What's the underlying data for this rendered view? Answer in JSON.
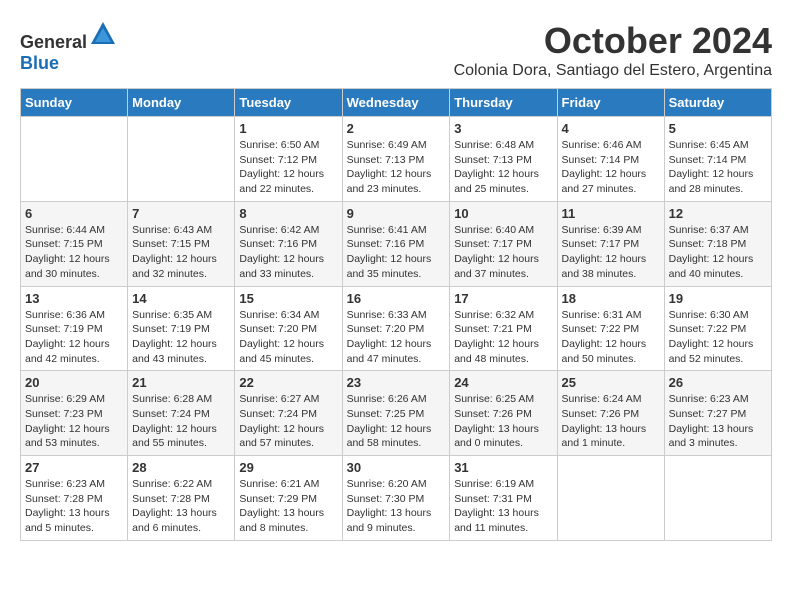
{
  "logo": {
    "general": "General",
    "blue": "Blue"
  },
  "title": {
    "month": "October 2024",
    "subtitle": "Colonia Dora, Santiago del Estero, Argentina"
  },
  "headers": [
    "Sunday",
    "Monday",
    "Tuesday",
    "Wednesday",
    "Thursday",
    "Friday",
    "Saturday"
  ],
  "weeks": [
    [
      {
        "day": "",
        "info": ""
      },
      {
        "day": "",
        "info": ""
      },
      {
        "day": "1",
        "info": "Sunrise: 6:50 AM\nSunset: 7:12 PM\nDaylight: 12 hours\nand 22 minutes."
      },
      {
        "day": "2",
        "info": "Sunrise: 6:49 AM\nSunset: 7:13 PM\nDaylight: 12 hours\nand 23 minutes."
      },
      {
        "day": "3",
        "info": "Sunrise: 6:48 AM\nSunset: 7:13 PM\nDaylight: 12 hours\nand 25 minutes."
      },
      {
        "day": "4",
        "info": "Sunrise: 6:46 AM\nSunset: 7:14 PM\nDaylight: 12 hours\nand 27 minutes."
      },
      {
        "day": "5",
        "info": "Sunrise: 6:45 AM\nSunset: 7:14 PM\nDaylight: 12 hours\nand 28 minutes."
      }
    ],
    [
      {
        "day": "6",
        "info": "Sunrise: 6:44 AM\nSunset: 7:15 PM\nDaylight: 12 hours\nand 30 minutes."
      },
      {
        "day": "7",
        "info": "Sunrise: 6:43 AM\nSunset: 7:15 PM\nDaylight: 12 hours\nand 32 minutes."
      },
      {
        "day": "8",
        "info": "Sunrise: 6:42 AM\nSunset: 7:16 PM\nDaylight: 12 hours\nand 33 minutes."
      },
      {
        "day": "9",
        "info": "Sunrise: 6:41 AM\nSunset: 7:16 PM\nDaylight: 12 hours\nand 35 minutes."
      },
      {
        "day": "10",
        "info": "Sunrise: 6:40 AM\nSunset: 7:17 PM\nDaylight: 12 hours\nand 37 minutes."
      },
      {
        "day": "11",
        "info": "Sunrise: 6:39 AM\nSunset: 7:17 PM\nDaylight: 12 hours\nand 38 minutes."
      },
      {
        "day": "12",
        "info": "Sunrise: 6:37 AM\nSunset: 7:18 PM\nDaylight: 12 hours\nand 40 minutes."
      }
    ],
    [
      {
        "day": "13",
        "info": "Sunrise: 6:36 AM\nSunset: 7:19 PM\nDaylight: 12 hours\nand 42 minutes."
      },
      {
        "day": "14",
        "info": "Sunrise: 6:35 AM\nSunset: 7:19 PM\nDaylight: 12 hours\nand 43 minutes."
      },
      {
        "day": "15",
        "info": "Sunrise: 6:34 AM\nSunset: 7:20 PM\nDaylight: 12 hours\nand 45 minutes."
      },
      {
        "day": "16",
        "info": "Sunrise: 6:33 AM\nSunset: 7:20 PM\nDaylight: 12 hours\nand 47 minutes."
      },
      {
        "day": "17",
        "info": "Sunrise: 6:32 AM\nSunset: 7:21 PM\nDaylight: 12 hours\nand 48 minutes."
      },
      {
        "day": "18",
        "info": "Sunrise: 6:31 AM\nSunset: 7:22 PM\nDaylight: 12 hours\nand 50 minutes."
      },
      {
        "day": "19",
        "info": "Sunrise: 6:30 AM\nSunset: 7:22 PM\nDaylight: 12 hours\nand 52 minutes."
      }
    ],
    [
      {
        "day": "20",
        "info": "Sunrise: 6:29 AM\nSunset: 7:23 PM\nDaylight: 12 hours\nand 53 minutes."
      },
      {
        "day": "21",
        "info": "Sunrise: 6:28 AM\nSunset: 7:24 PM\nDaylight: 12 hours\nand 55 minutes."
      },
      {
        "day": "22",
        "info": "Sunrise: 6:27 AM\nSunset: 7:24 PM\nDaylight: 12 hours\nand 57 minutes."
      },
      {
        "day": "23",
        "info": "Sunrise: 6:26 AM\nSunset: 7:25 PM\nDaylight: 12 hours\nand 58 minutes."
      },
      {
        "day": "24",
        "info": "Sunrise: 6:25 AM\nSunset: 7:26 PM\nDaylight: 13 hours\nand 0 minutes."
      },
      {
        "day": "25",
        "info": "Sunrise: 6:24 AM\nSunset: 7:26 PM\nDaylight: 13 hours\nand 1 minute."
      },
      {
        "day": "26",
        "info": "Sunrise: 6:23 AM\nSunset: 7:27 PM\nDaylight: 13 hours\nand 3 minutes."
      }
    ],
    [
      {
        "day": "27",
        "info": "Sunrise: 6:23 AM\nSunset: 7:28 PM\nDaylight: 13 hours\nand 5 minutes."
      },
      {
        "day": "28",
        "info": "Sunrise: 6:22 AM\nSunset: 7:28 PM\nDaylight: 13 hours\nand 6 minutes."
      },
      {
        "day": "29",
        "info": "Sunrise: 6:21 AM\nSunset: 7:29 PM\nDaylight: 13 hours\nand 8 minutes."
      },
      {
        "day": "30",
        "info": "Sunrise: 6:20 AM\nSunset: 7:30 PM\nDaylight: 13 hours\nand 9 minutes."
      },
      {
        "day": "31",
        "info": "Sunrise: 6:19 AM\nSunset: 7:31 PM\nDaylight: 13 hours\nand 11 minutes."
      },
      {
        "day": "",
        "info": ""
      },
      {
        "day": "",
        "info": ""
      }
    ]
  ]
}
